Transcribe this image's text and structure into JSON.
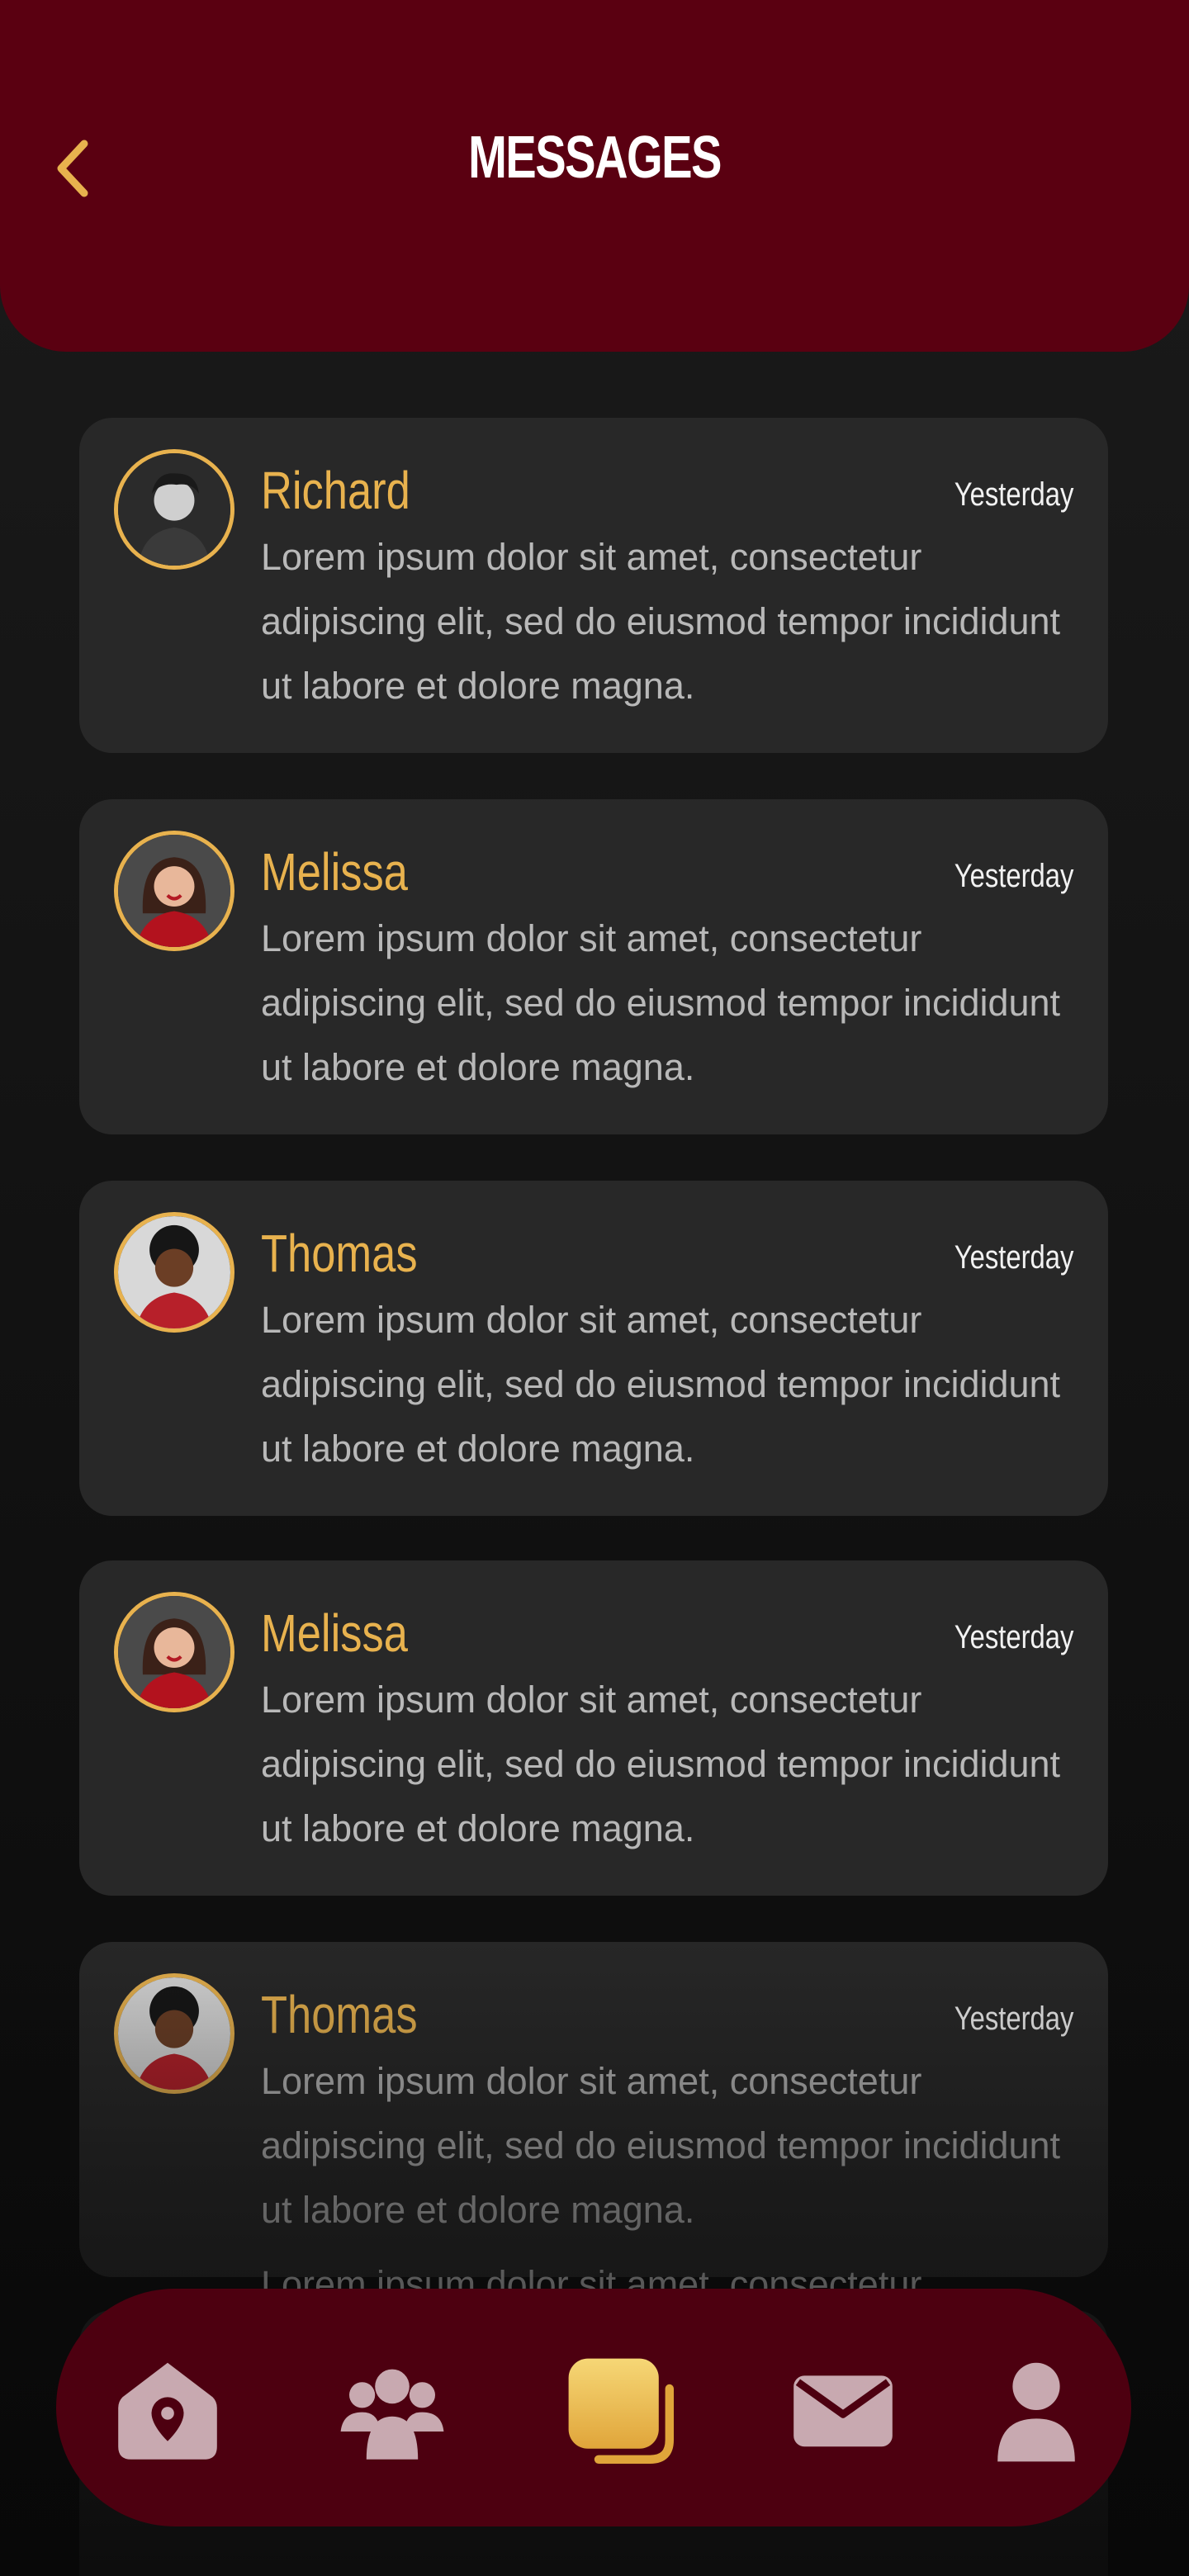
{
  "header": {
    "title": "MESSAGES",
    "back_icon": "chevron-left-icon"
  },
  "messages": [
    {
      "name": "Richard",
      "time": "Yesterday",
      "text": "Lorem ipsum dolor sit amet, consectetur adipiscing elit, sed do eiusmod tempor incididunt ut labore et dolore magna."
    },
    {
      "name": "Melissa",
      "time": "Yesterday",
      "text": "Lorem ipsum dolor sit amet, consectetur adipiscing elit, sed do eiusmod tempor incididunt ut labore et dolore magna."
    },
    {
      "name": "Thomas",
      "time": "Yesterday",
      "text": "Lorem ipsum dolor sit amet, consectetur adipiscing elit, sed do eiusmod tempor incididunt ut labore et dolore magna."
    },
    {
      "name": "Melissa",
      "time": "Yesterday",
      "text": "Lorem ipsum dolor sit amet, consectetur adipiscing elit, sed do eiusmod tempor incididunt ut labore et dolore magna."
    },
    {
      "name": "Thomas",
      "time": "Yesterday",
      "text": "Lorem ipsum dolor sit amet, consectetur adipiscing elit, sed do eiusmod tempor incididunt ut labore et dolore magna."
    },
    {
      "name": "",
      "time": "",
      "text": "Lorem ipsum dolor sit amet, consectetur adipiscing elit, sed do eiusmod tempor incididunt ut labore et dolore magna."
    }
  ],
  "nav": {
    "items": [
      {
        "icon": "home-location-icon",
        "active": false
      },
      {
        "icon": "users-icon",
        "active": false
      },
      {
        "icon": "cards-icon",
        "active": true
      },
      {
        "icon": "mail-icon",
        "active": false
      },
      {
        "icon": "profile-icon",
        "active": false
      }
    ]
  },
  "colors": {
    "header_bg": "#5a0011",
    "accent": "#e8b24e",
    "card_bg": "#282828",
    "nav_bg": "#4d0010",
    "nav_icon": "#c8a9b0"
  }
}
